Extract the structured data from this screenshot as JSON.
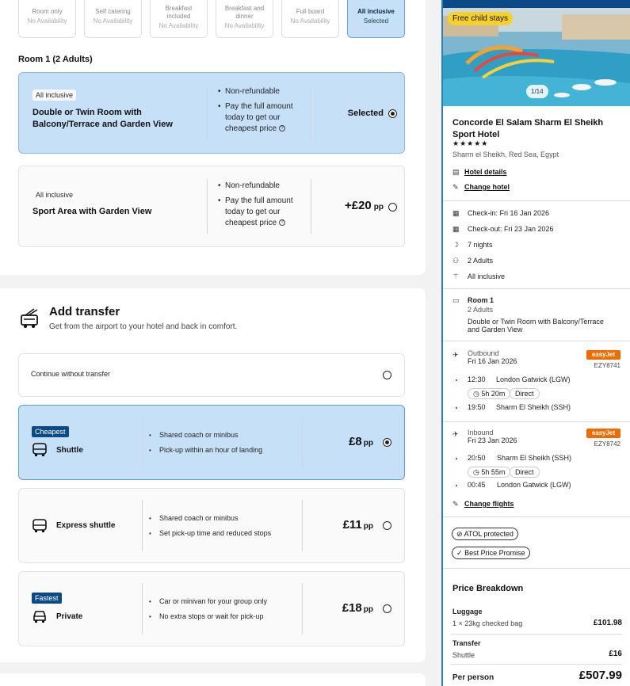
{
  "boards": [
    {
      "name": "Room only",
      "availability": "No Availability"
    },
    {
      "name": "Self catering",
      "availability": "No Availability"
    },
    {
      "name": "Breakfast included",
      "availability": "No Availability"
    },
    {
      "name": "Breakfast and dinner",
      "availability": "No Availability"
    },
    {
      "name": "Full board",
      "availability": "No Availability"
    },
    {
      "name": "All inclusive",
      "availability": "Selected"
    }
  ],
  "room": {
    "title": "Room 1 (2 Adults)",
    "options": [
      {
        "badge": "All inclusive",
        "name": "Double or Twin Room with Balcony/Terrace and Garden View",
        "bullets": [
          "Non-refundable",
          "Pay the full amount today to get our cheapest price"
        ],
        "price_label": "Selected"
      },
      {
        "badge": "All inclusive",
        "name": "Sport Area with Garden View",
        "bullets": [
          "Non-refundable",
          "Pay the full amount today to get our cheapest price"
        ],
        "price": "+£20",
        "unit": "pp"
      }
    ]
  },
  "transfer": {
    "title": "Add transfer",
    "subtitle": "Get from the airport to your hotel and back in comfort.",
    "no_transfer": "Continue without transfer",
    "options": [
      {
        "badge": "Cheapest",
        "name": "Shuttle",
        "bullets": [
          "Shared coach or minibus",
          "Pick-up within an hour of landing"
        ],
        "price": "£8",
        "unit": "pp"
      },
      {
        "name": "Express shuttle",
        "bullets": [
          "Shared coach or minibus",
          "Set pick-up time and reduced stops"
        ],
        "price": "£11",
        "unit": "pp"
      },
      {
        "badge": "Fastest",
        "name": "Private",
        "bullets": [
          "Car or minivan for your group only",
          "No extra stops or wait for pick-up"
        ],
        "price": "£18",
        "unit": "pp"
      }
    ]
  },
  "summary": {
    "child_tag": "Free child stays",
    "img_count": "1/14",
    "hotel_name": "Concorde El Salam Sharm El Sheikh Sport Hotel",
    "stars": "★★★★★",
    "location": "Sharm el Sheikh, Red Sea, Egypt",
    "hotel_details": "Hotel details",
    "change_hotel": "Change hotel",
    "checkin": "Check-in: Fri 16 Jan 2026",
    "checkout": "Check-out: Fri 23 Jan 2026",
    "nights": "7 nights",
    "adults": "2 Adults",
    "board": "All inclusive",
    "room_title": "Room 1",
    "room_adults": "2 Adults",
    "room_name": "Double or Twin Room with Balcony/Terrace and Garden View",
    "outbound": {
      "label": "Outbound",
      "date": "Fri 16 Jan 2026",
      "airline": "easyJet",
      "flight_no": "EZY8741",
      "dep_time": "12:30",
      "dep_airport": "London Gatwick (LGW)",
      "duration": "5h 20m",
      "stops": "Direct",
      "arr_time": "19:50",
      "arr_airport": "Sharm El Sheikh (SSH)"
    },
    "inbound": {
      "label": "Inbound",
      "date": "Fri 23 Jan 2026",
      "airline": "easyJet",
      "flight_no": "EZY8742",
      "dep_time": "20:50",
      "dep_airport": "Sharm El Sheikh (SSH)",
      "duration": "5h 55m",
      "stops": "Direct",
      "arr_time": "00:45",
      "arr_airport": "London Gatwick (LGW)"
    },
    "change_flights": "Change flights",
    "atol": "ATOL protected",
    "best_price": "Best Price Promise",
    "price_breakdown": "Price Breakdown",
    "luggage_label": "Luggage",
    "luggage_desc": "1 × 23kg checked bag",
    "luggage_price": "£101.98",
    "transfer_label": "Transfer",
    "transfer_desc": "Shuttle",
    "transfer_price": "£16",
    "per_person_label": "Per person",
    "per_person_price": "£507.99"
  },
  "colors": {
    "selected_bg": "#c6e0f8",
    "brand_navy": "#0b4a86",
    "easyjet": "#f06c00",
    "child_tag": "#f7d12a"
  }
}
